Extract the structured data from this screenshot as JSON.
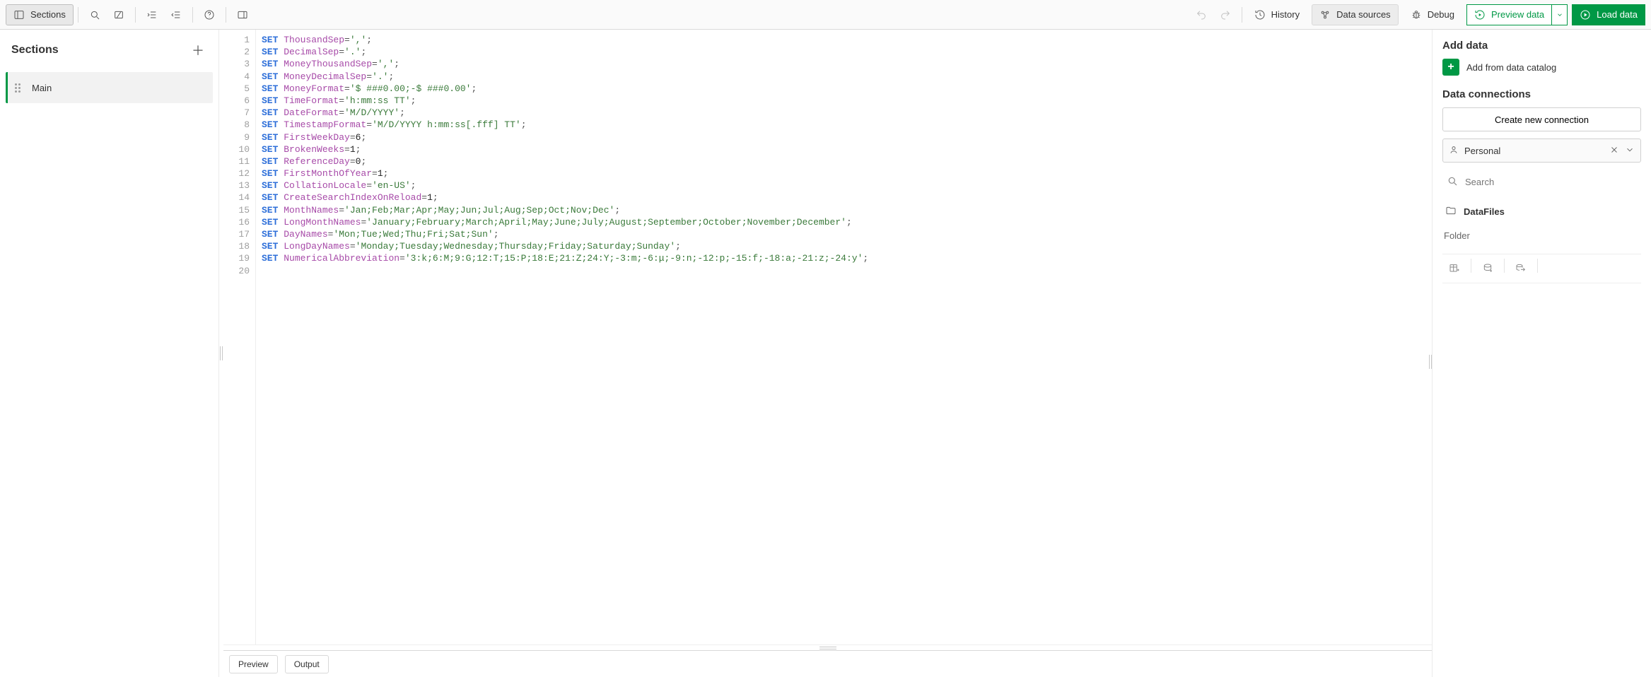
{
  "toolbar": {
    "sections_label": "Sections",
    "history_label": "History",
    "data_sources_label": "Data sources",
    "debug_label": "Debug",
    "preview_label": "Preview data",
    "load_label": "Load data"
  },
  "left": {
    "title": "Sections",
    "items": [
      {
        "label": "Main"
      }
    ]
  },
  "editor": {
    "lines": [
      {
        "n": 1,
        "kw": "SET",
        "ident": "ThousandSep",
        "rest_op1": "=",
        "rest_str": "','",
        "rest_op2": ";"
      },
      {
        "n": 2,
        "kw": "SET",
        "ident": "DecimalSep",
        "rest_op1": "=",
        "rest_str": "'.'",
        "rest_op2": ";"
      },
      {
        "n": 3,
        "kw": "SET",
        "ident": "MoneyThousandSep",
        "rest_op1": "=",
        "rest_str": "','",
        "rest_op2": ";"
      },
      {
        "n": 4,
        "kw": "SET",
        "ident": "MoneyDecimalSep",
        "rest_op1": "=",
        "rest_str": "'.'",
        "rest_op2": ";"
      },
      {
        "n": 5,
        "kw": "SET",
        "ident": "MoneyFormat",
        "rest_op1": "=",
        "rest_str": "'$ ###0.00;-$ ###0.00'",
        "rest_op2": ";"
      },
      {
        "n": 6,
        "kw": "SET",
        "ident": "TimeFormat",
        "rest_op1": "=",
        "rest_str": "'h:mm:ss TT'",
        "rest_op2": ";"
      },
      {
        "n": 7,
        "kw": "SET",
        "ident": "DateFormat",
        "rest_op1": "=",
        "rest_str": "'M/D/YYYY'",
        "rest_op2": ";"
      },
      {
        "n": 8,
        "kw": "SET",
        "ident": "TimestampFormat",
        "rest_op1": "=",
        "rest_str": "'M/D/YYYY h:mm:ss[.fff] TT'",
        "rest_op2": ";"
      },
      {
        "n": 9,
        "kw": "SET",
        "ident": "FirstWeekDay",
        "rest_op1": "=",
        "rest_num": "6",
        "rest_op2": ";"
      },
      {
        "n": 10,
        "kw": "SET",
        "ident": "BrokenWeeks",
        "rest_op1": "=",
        "rest_num": "1",
        "rest_op2": ";"
      },
      {
        "n": 11,
        "kw": "SET",
        "ident": "ReferenceDay",
        "rest_op1": "=",
        "rest_num": "0",
        "rest_op2": ";"
      },
      {
        "n": 12,
        "kw": "SET",
        "ident": "FirstMonthOfYear",
        "rest_op1": "=",
        "rest_num": "1",
        "rest_op2": ";"
      },
      {
        "n": 13,
        "kw": "SET",
        "ident": "CollationLocale",
        "rest_op1": "=",
        "rest_str": "'en-US'",
        "rest_op2": ";"
      },
      {
        "n": 14,
        "kw": "SET",
        "ident": "CreateSearchIndexOnReload",
        "rest_op1": "=",
        "rest_num": "1",
        "rest_op2": ";"
      },
      {
        "n": 15,
        "kw": "SET",
        "ident": "MonthNames",
        "rest_op1": "=",
        "rest_str": "'Jan;Feb;Mar;Apr;May;Jun;Jul;Aug;Sep;Oct;Nov;Dec'",
        "rest_op2": ";"
      },
      {
        "n": 16,
        "kw": "SET",
        "ident": "LongMonthNames",
        "rest_op1": "=",
        "rest_str": "'January;February;March;April;May;June;July;August;September;October;November;December'",
        "rest_op2": ";"
      },
      {
        "n": 17,
        "kw": "SET",
        "ident": "DayNames",
        "rest_op1": "=",
        "rest_str": "'Mon;Tue;Wed;Thu;Fri;Sat;Sun'",
        "rest_op2": ";"
      },
      {
        "n": 18,
        "kw": "SET",
        "ident": "LongDayNames",
        "rest_op1": "=",
        "rest_str": "'Monday;Tuesday;Wednesday;Thursday;Friday;Saturday;Sunday'",
        "rest_op2": ";"
      },
      {
        "n": 19,
        "kw": "SET",
        "ident": "NumericalAbbreviation",
        "rest_op1": "=",
        "rest_str": "'3:k;6:M;9:G;12:T;15:P;18:E;21:Z;24:Y;-3:m;-6:μ;-9:n;-12:p;-15:f;-18:a;-21:z;-24:y'",
        "rest_op2": ";"
      },
      {
        "n": 20
      }
    ]
  },
  "bottom": {
    "tabs": [
      {
        "label": "Preview"
      },
      {
        "label": "Output"
      }
    ]
  },
  "right": {
    "add_data_title": "Add data",
    "add_catalog_label": "Add from data catalog",
    "connections_title": "Data connections",
    "create_conn_label": "Create new connection",
    "space_label": "Personal",
    "search_placeholder": "Search",
    "folder_item": "DataFiles",
    "folder_caption": "Folder"
  }
}
